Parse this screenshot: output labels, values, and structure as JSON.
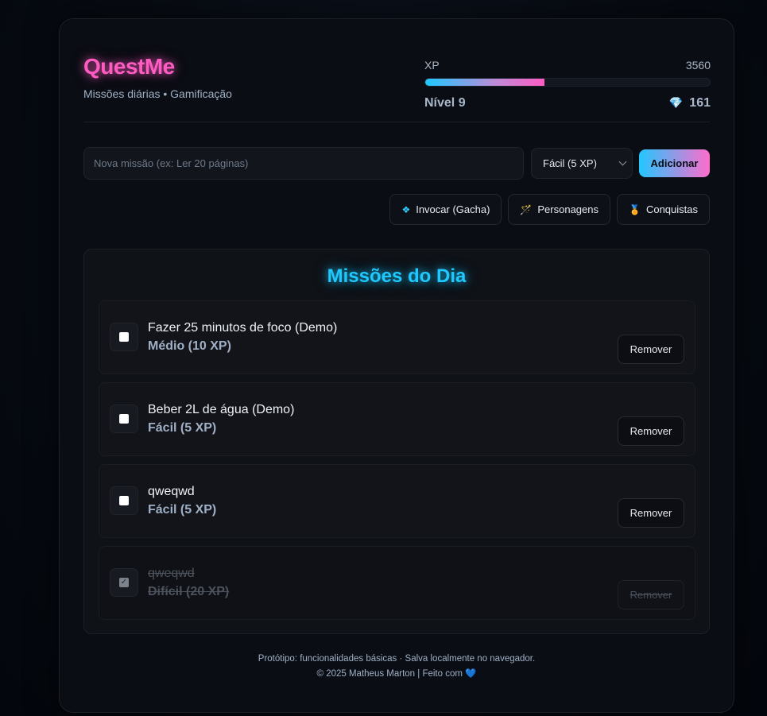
{
  "brand": {
    "title": "QuestMe",
    "subtitle": "Missões diárias • Gamificação"
  },
  "xp": {
    "label": "XP",
    "value": "3560",
    "progress_fraction": 0.42,
    "level_label": "Nível 9",
    "gems": "161",
    "gem_icon": "💎"
  },
  "add_form": {
    "input_placeholder": "Nova missão (ex: Ler 20 páginas)",
    "input_value": "",
    "difficulty_selected": "Fácil (5 XP)",
    "add_label": "Adicionar"
  },
  "actions": [
    {
      "icon": "❖",
      "label": "Invocar (Gacha)"
    },
    {
      "icon": "🪄",
      "label": "Personagens"
    },
    {
      "icon": "🏅",
      "label": "Conquistas"
    }
  ],
  "panel": {
    "title": "Missões do Dia",
    "remove_label": "Remover",
    "missions": [
      {
        "name": "Fazer 25 minutos de foco (Demo)",
        "difficulty": "Médio (10 XP)",
        "done": false
      },
      {
        "name": "Beber 2L de água (Demo)",
        "difficulty": "Fácil (5 XP)",
        "done": false
      },
      {
        "name": "qweqwd",
        "difficulty": "Fácil (5 XP)",
        "done": false
      },
      {
        "name": "qweqwd",
        "difficulty": "Difícil (20 XP)",
        "done": true
      }
    ]
  },
  "footer": {
    "line1": "Protótipo: funcionalidades básicas · Salva localmente no navegador.",
    "line2": "© 2025 Matheus Marton | Feito com",
    "heart": "💙"
  },
  "colors": {
    "brand_pink": "#ff5cc3",
    "accent_cyan": "#1fc9ff",
    "background": "#0a0d13"
  }
}
